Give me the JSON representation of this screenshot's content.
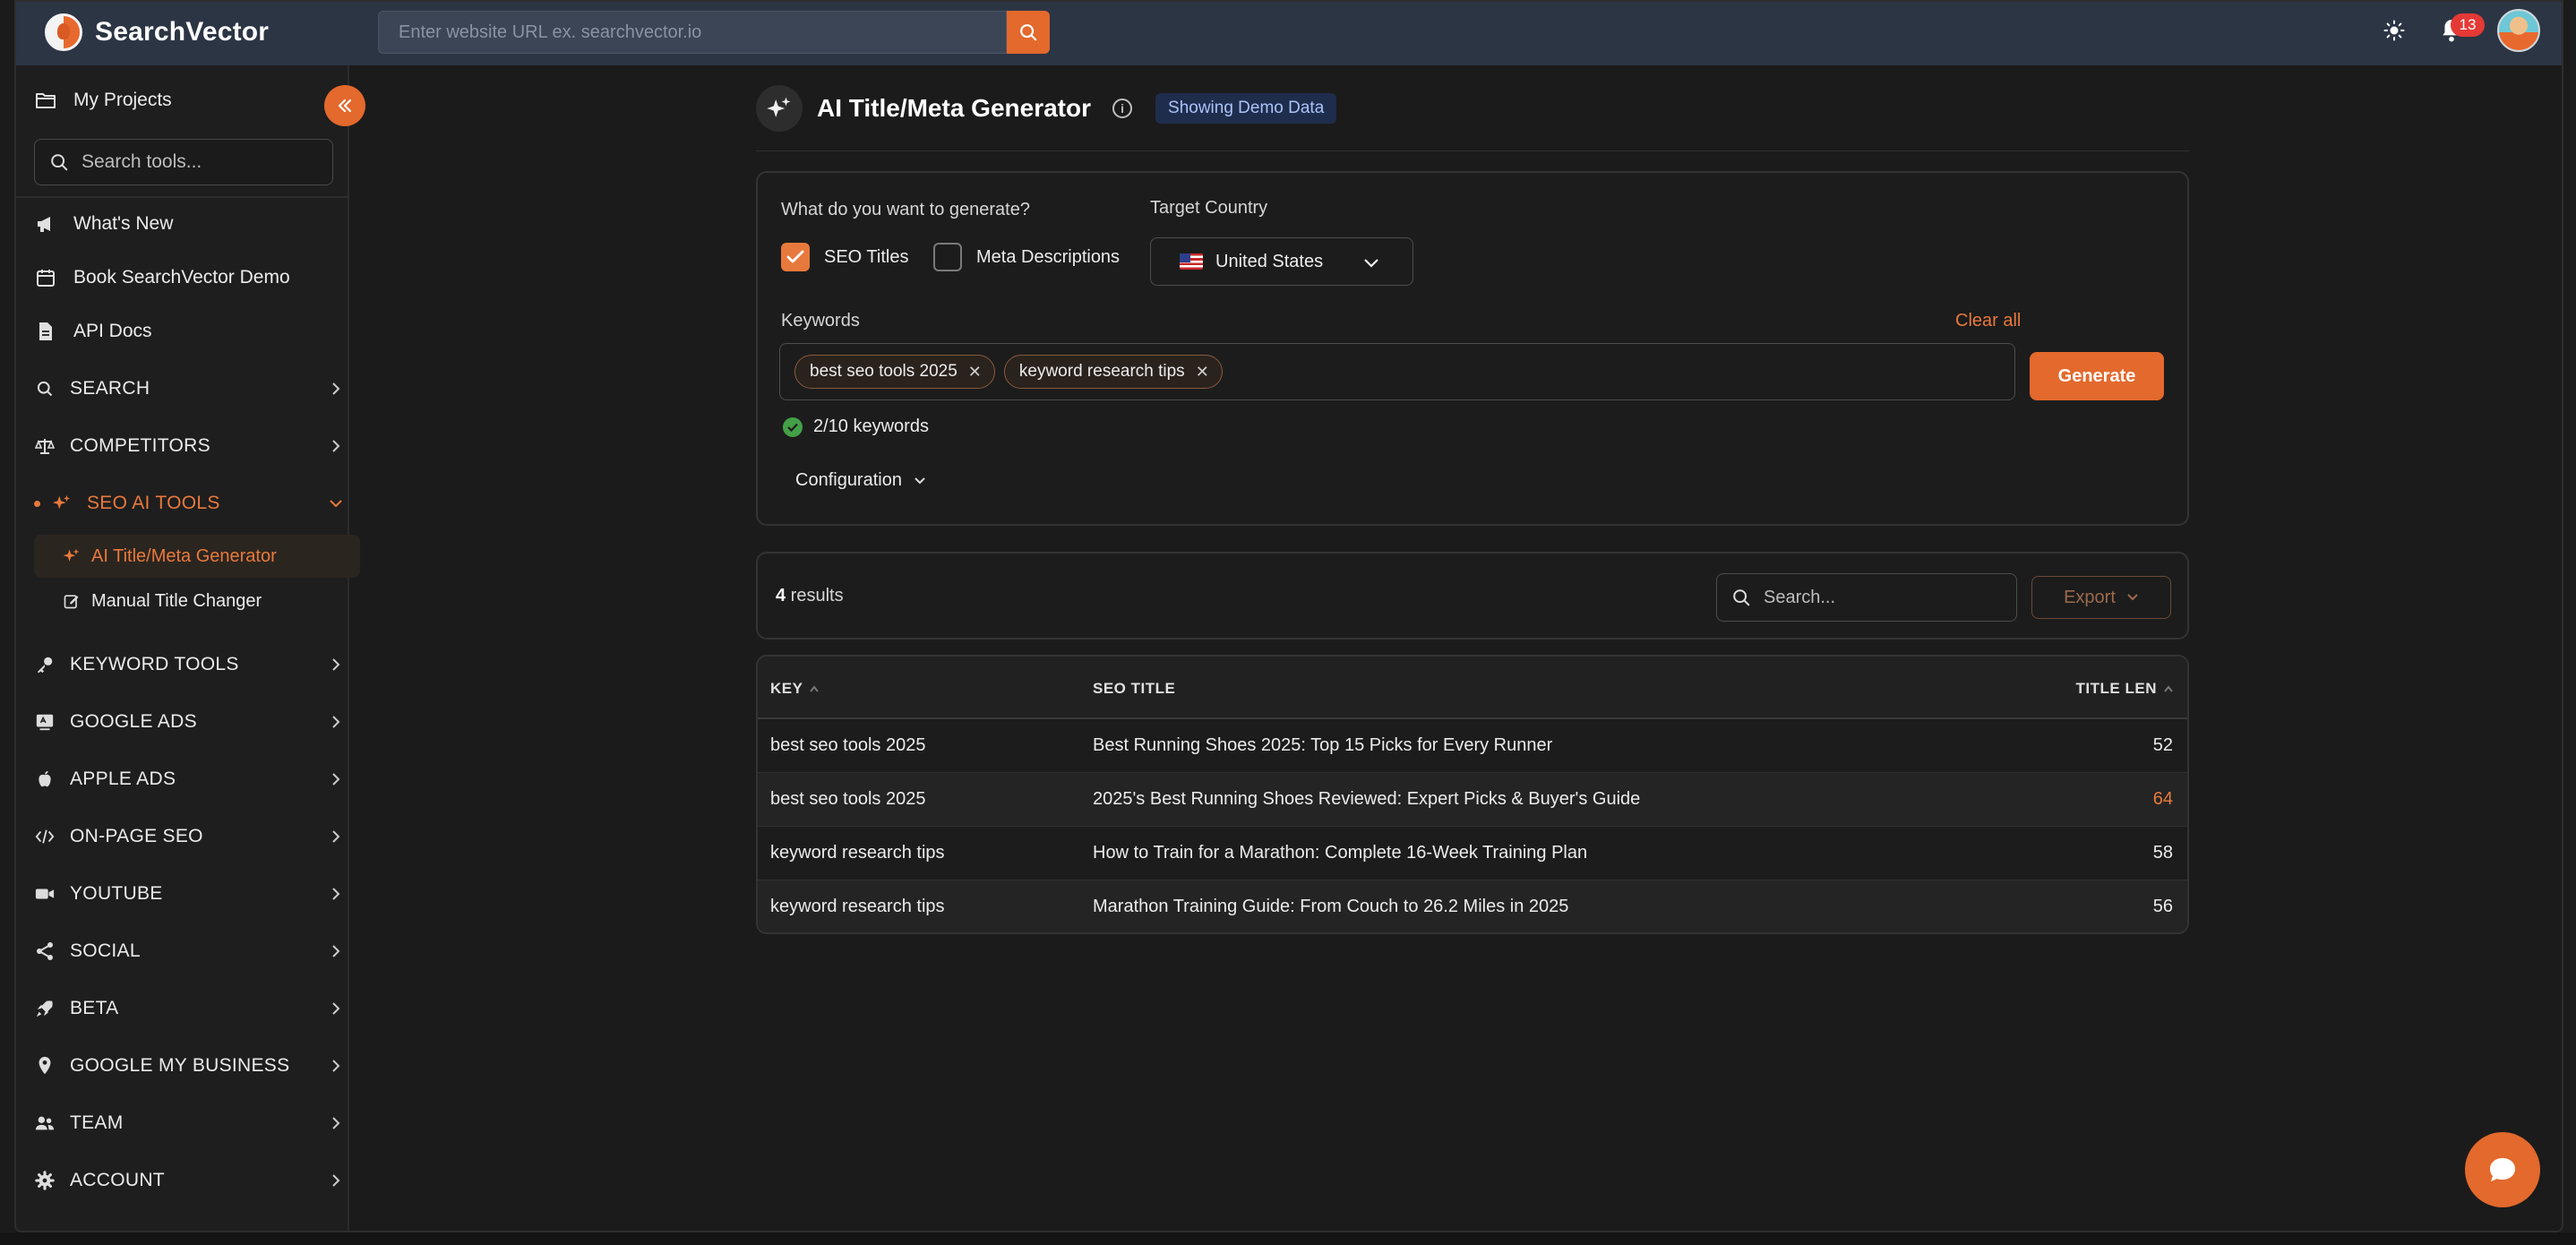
{
  "app": {
    "name": "SearchVector",
    "url_placeholder": "Enter website URL ex. searchvector.io",
    "notification_count": "13"
  },
  "sidebar": {
    "my_projects": "My Projects",
    "search_placeholder": "Search tools...",
    "links": [
      {
        "label": "What's New",
        "icon": "megaphone-icon"
      },
      {
        "label": "Book SearchVector Demo",
        "icon": "calendar-icon"
      },
      {
        "label": "API Docs",
        "icon": "document-icon"
      }
    ],
    "sections": [
      {
        "label": "SEARCH",
        "icon": "search-icon"
      },
      {
        "label": "COMPETITORS",
        "icon": "scales-icon"
      },
      {
        "label": "SEO AI TOOLS",
        "icon": "sparkles-icon",
        "active": true
      },
      {
        "label": "KEYWORD TOOLS",
        "icon": "key-icon"
      },
      {
        "label": "GOOGLE ADS",
        "icon": "ad-icon"
      },
      {
        "label": "APPLE ADS",
        "icon": "apple-icon"
      },
      {
        "label": "ON-PAGE SEO",
        "icon": "code-icon"
      },
      {
        "label": "YOUTUBE",
        "icon": "video-icon"
      },
      {
        "label": "SOCIAL",
        "icon": "share-icon"
      },
      {
        "label": "BETA",
        "icon": "rocket-icon"
      },
      {
        "label": "GOOGLE MY BUSINESS",
        "icon": "pin-icon"
      },
      {
        "label": "TEAM",
        "icon": "users-icon"
      },
      {
        "label": "ACCOUNT",
        "icon": "gear-icon"
      }
    ],
    "sub_items": [
      {
        "label": "AI Title/Meta Generator",
        "active": true
      },
      {
        "label": "Manual Title Changer",
        "active": false
      }
    ]
  },
  "page": {
    "title": "AI Title/Meta Generator",
    "badge": "Showing Demo Data"
  },
  "form": {
    "question": "What do you want to generate?",
    "opt_seo_titles": "SEO Titles",
    "opt_seo_titles_checked": true,
    "opt_meta": "Meta Descriptions",
    "opt_meta_checked": false,
    "country_label": "Target Country",
    "country_value": "United States",
    "keywords_label": "Keywords",
    "clear_all": "Clear all",
    "keywords": [
      "best seo tools 2025",
      "keyword research tips"
    ],
    "keyword_count": "2/10 keywords",
    "generate": "Generate",
    "configuration": "Configuration"
  },
  "results": {
    "count": "4",
    "count_suffix": " results",
    "search_placeholder": "Search...",
    "export": "Export",
    "columns": {
      "key": "KEY",
      "seo_title": "SEO TITLE",
      "title_len": "TITLE LEN"
    },
    "rows": [
      {
        "key": "best seo tools 2025",
        "title": "Best Running Shoes 2025: Top 15 Picks for Every Runner",
        "len": "52",
        "warn": false
      },
      {
        "key": "best seo tools 2025",
        "title": "2025's Best Running Shoes Reviewed: Expert Picks & Buyer's Guide",
        "len": "64",
        "warn": true
      },
      {
        "key": "keyword research tips",
        "title": "How to Train for a Marathon: Complete 16-Week Training Plan",
        "len": "58",
        "warn": false
      },
      {
        "key": "keyword research tips",
        "title": "Marathon Training Guide: From Couch to 26.2 Miles in 2025",
        "len": "56",
        "warn": false
      }
    ]
  },
  "colors": {
    "accent": "#e3692c",
    "topbar": "#2c3544",
    "background": "#1b1b1b"
  }
}
